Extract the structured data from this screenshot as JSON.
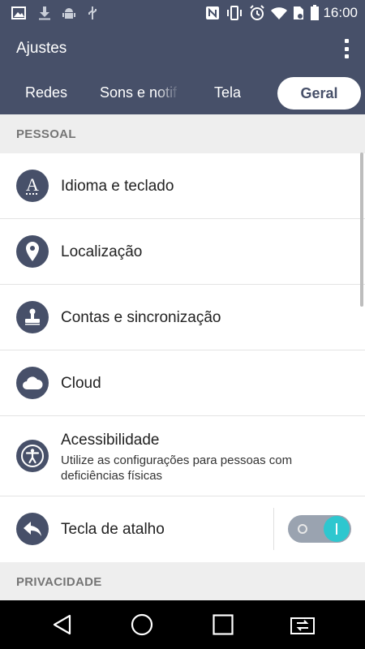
{
  "status_bar": {
    "time": "16:00",
    "icons": [
      "image-icon",
      "download-icon",
      "android-debug-icon",
      "usb-icon",
      "nfc-icon",
      "vibrate-icon",
      "alarm-icon",
      "wifi-icon",
      "sim-no-icon",
      "battery-icon"
    ]
  },
  "app_bar": {
    "title": "Ajustes",
    "overflow_icon": "more-vertical-icon"
  },
  "tabs": [
    {
      "label": "Redes",
      "active": false
    },
    {
      "label": "Sons e notificações",
      "active": false
    },
    {
      "label": "Tela",
      "active": false
    },
    {
      "label": "Geral",
      "active": true
    }
  ],
  "sections": [
    {
      "header": "PESSOAL",
      "items": [
        {
          "title": "Idioma e teclado",
          "icon": "language-icon"
        },
        {
          "title": "Localização",
          "icon": "location-pin-icon"
        },
        {
          "title": "Contas e sincronização",
          "icon": "stamp-icon"
        },
        {
          "title": "Cloud",
          "icon": "cloud-icon"
        },
        {
          "title": "Acessibilidade",
          "subtitle": "Utilize as configurações para pessoas com deficiências físicas",
          "icon": "accessibility-icon"
        },
        {
          "title": "Tecla de atalho",
          "icon": "reply-arrow-icon",
          "toggle_on": true
        }
      ]
    },
    {
      "header": "PRIVACIDADE",
      "items": []
    }
  ],
  "nav_bar": {
    "icons": [
      "back-icon",
      "home-icon",
      "recents-icon",
      "dual-window-icon"
    ]
  },
  "colors": {
    "accent": "#475069",
    "toggle_on": "#2ec7cf",
    "section_bg": "#eeeeee"
  }
}
